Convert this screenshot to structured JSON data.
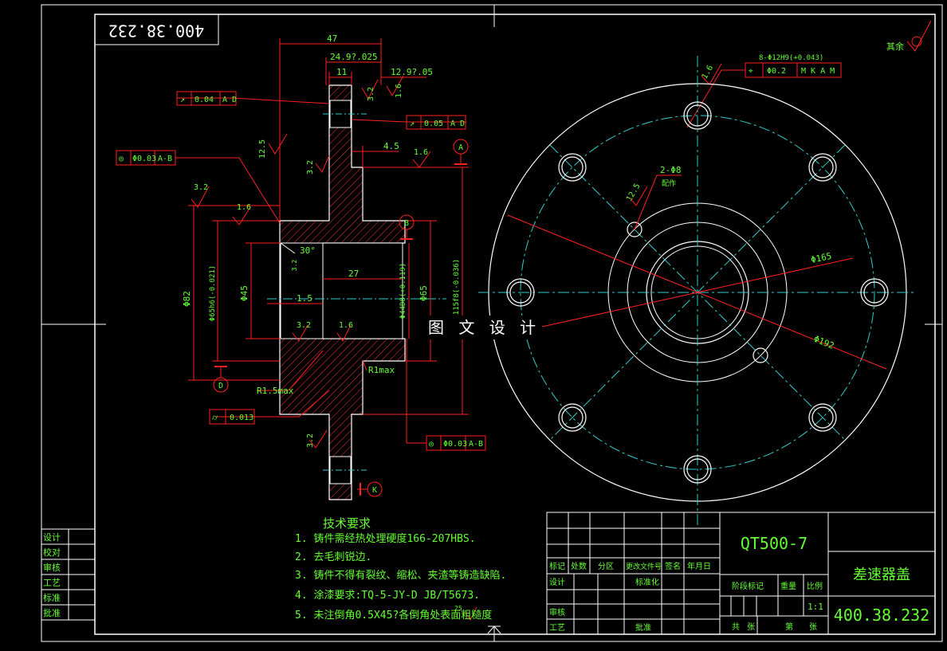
{
  "colors": {
    "background": "#000000",
    "frame": "#ffffff",
    "dimension": "#ff2020",
    "text": "#66ff33",
    "centerline": "#33cccc",
    "hatch": "#ff3333"
  },
  "drawing_number_rotated": "400.38.232",
  "watermark": "图 文 设 计",
  "surface_note": "其余",
  "dims": {
    "d47": "47",
    "d24": "24.9?.025",
    "d12": "12.9?.05",
    "d11": "11",
    "d45": "4.5",
    "d27": "27",
    "d15": "1.5",
    "d30": "30°",
    "d82": "Φ82",
    "d65h": "Φ65h6(-0.021)",
    "d45b": "Φ45",
    "d44": "Φ44D8(+0.119)",
    "d65": "Φ65",
    "d115": "115f8(-0.036)",
    "r15": "R1.5max",
    "r1": "R1max",
    "h8": "8-Φ12H9(+0.043)",
    "h2": "2-Φ8",
    "h2note": "配作",
    "d165": "Φ165",
    "d192": "Φ192"
  },
  "roughness": {
    "r32": "3.2",
    "r16": "1.6",
    "r125": "12.5",
    "r25": "25"
  },
  "tolerances": {
    "t1": {
      "sym": "↗",
      "val": "0.04",
      "ref": "A D"
    },
    "t2": {
      "sym": "↗",
      "val": "0.05",
      "ref": "A D"
    },
    "t3": {
      "sym": "◎",
      "val": "Φ0.03",
      "ref": "A-B"
    },
    "t4": {
      "sym": "◎",
      "val": "Φ0.03",
      "ref": "A-B"
    },
    "t5": {
      "sym": "⌭",
      "val": "0.013",
      "ref": ""
    },
    "t6": {
      "sym": "⌖",
      "val": "Φ0.2",
      "ref": "M K A M"
    }
  },
  "datums": {
    "a": "A",
    "b": "B",
    "d": "D",
    "k": "K"
  },
  "tech": {
    "title": "技术要求",
    "items": [
      "1.  铸件需经热处理硬度166-207HBS.",
      "2.  去毛刺锐边.",
      "3.  铸件不得有裂纹、缩松、夹渣等铸造缺陷.",
      "4.  涂漆要求:TQ-5-JY-D JB/T5673.",
      "5.  未注倒角0.5X45?各倒角处表面粗糙度"
    ]
  },
  "left_table": [
    "设计",
    "校对",
    "审核",
    "工艺",
    "标准",
    "批准"
  ],
  "title_block": {
    "material": "QT500-7",
    "part_name": "差速器盖",
    "drawing_no": "400.38.232",
    "scale": "1:1",
    "rev_headers": [
      "标记",
      "处数",
      "分区",
      "更改文件号",
      "签名",
      "年月日"
    ],
    "row_design": "设计",
    "row_std": "标准化",
    "row_review": "审核",
    "row_process": "工艺",
    "row_approve": "批准",
    "stage": "阶段标记",
    "weight": "重量",
    "ratio": "比例",
    "total": "共",
    "sheet1": "张",
    "sheet2": "第",
    "sheet3": "张"
  }
}
